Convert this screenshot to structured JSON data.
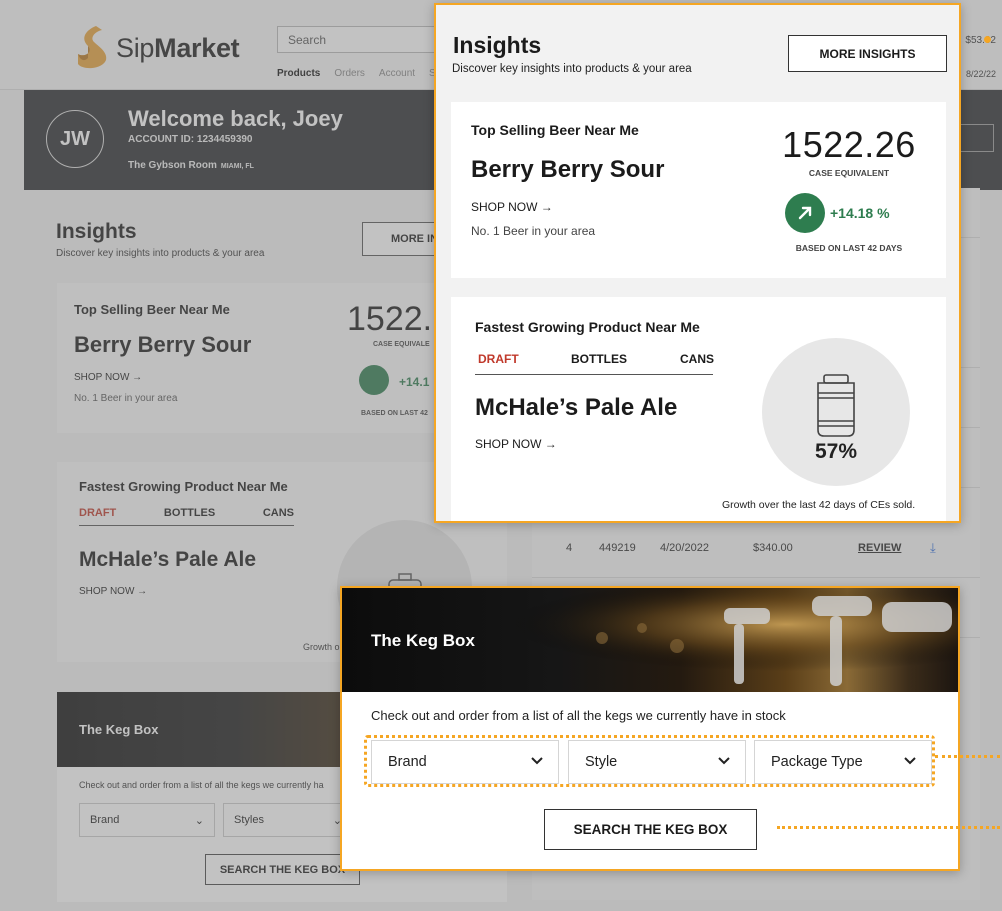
{
  "brand": {
    "name_light": "Sip",
    "name_bold": "Market"
  },
  "header": {
    "search_placeholder": "Search",
    "nav": [
      "Products",
      "Orders",
      "Account",
      "S"
    ],
    "right_top": "$53.02",
    "right_date": "8/22/22"
  },
  "welcome": {
    "initials": "JW",
    "title": "Welcome back, Joey",
    "account": "ACCOUNT ID: 1234459390",
    "venue": "The Gybson Room",
    "location": "MIAMI, FL"
  },
  "insights": {
    "title": "Insights",
    "subtitle": "Discover key insights into products & your area",
    "more_label": "MORE INSIGHTS",
    "more_label_cut": "MORE IN",
    "top_selling": {
      "heading": "Top Selling Beer Near Me",
      "product": "Berry Berry Sour",
      "shop": "SHOP NOW →",
      "note": "No. 1 Beer in your area",
      "value": "1522.26",
      "value_cut": "1522.",
      "unit": "CASE EQUIVALENT",
      "unit_cut": "CASE EQUIVALE",
      "growth": "+14.18 %",
      "growth_cut": "+14.1",
      "basis": "BASED ON LAST 42 DAYS",
      "basis_cut": "BASED ON LAST 42"
    },
    "fastest": {
      "heading": "Fastest Growing Product Near Me",
      "tabs": [
        "DRAFT",
        "BOTTLES",
        "CANS"
      ],
      "active_tab": "DRAFT",
      "product": "McHale’s Pale Ale",
      "shop": "SHOP NOW →",
      "percent": "57%",
      "caption": "Growth over the last 42 days of CEs sold.",
      "caption_cut": "Growth o"
    }
  },
  "keg_box": {
    "title": "The Keg Box",
    "description": "Check out and order from a list of all the kegs we currently have in stock",
    "description_cut": "Check out and order from a list of all the kegs we currently ha",
    "selects": [
      "Brand",
      "Style",
      "Package Type"
    ],
    "bg_selects": [
      "Brand",
      "Styles"
    ],
    "button": "SEARCH THE KEG BOX",
    "button_cut": "SEARCH THE KEG BOX"
  },
  "orders_row": {
    "index": "4",
    "order_id": "449219",
    "date": "4/20/2022",
    "amount": "$340.00",
    "action": "REVIEW"
  },
  "colors": {
    "accent": "#f5a623",
    "growth_green": "#2e7d4f",
    "active_tab_red": "#c0392b",
    "dark_banner": "#2b2d30"
  }
}
